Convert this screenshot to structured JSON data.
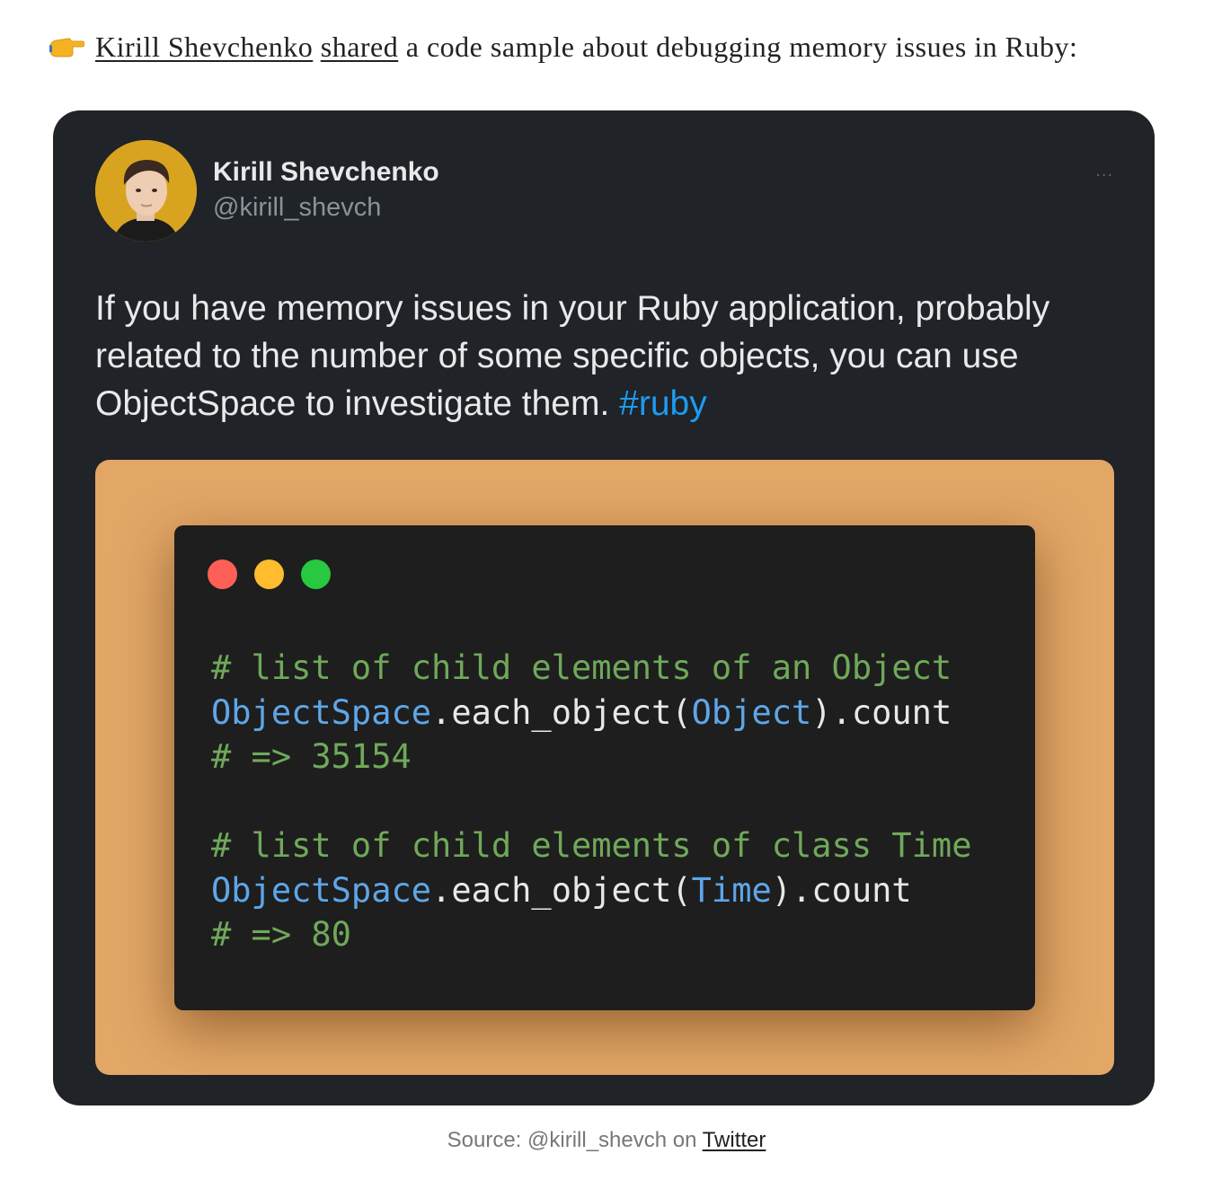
{
  "intro": {
    "emoji": "👉",
    "author_link": "Kirill Shevchenko",
    "shared_link": "shared",
    "text": "a code sample about debugging memory issues in Ruby:"
  },
  "tweet": {
    "author_name": "Kirill Shevchenko",
    "author_handle": "@kirill_shevch",
    "more_icon": "...",
    "text": "If you have memory issues in your Ruby application, probably related to the number of some specific objects, you can use ObjectSpace to investigate them.",
    "hashtag": "#ruby",
    "media": {
      "window_dots": [
        "red",
        "yellow",
        "green"
      ],
      "code_lines": [
        [
          {
            "t": "# list of child elements of an Object",
            "k": "cm"
          }
        ],
        [
          {
            "t": "ObjectSpace",
            "k": "cls"
          },
          {
            "t": ".each_object(",
            "k": "plain"
          },
          {
            "t": "Object",
            "k": "cls"
          },
          {
            "t": ").count",
            "k": "plain"
          }
        ],
        [
          {
            "t": "# => 35154",
            "k": "cm"
          }
        ],
        [],
        [
          {
            "t": "# list of child elements of class Time",
            "k": "cm"
          }
        ],
        [
          {
            "t": "ObjectSpace",
            "k": "cls"
          },
          {
            "t": ".each_object(",
            "k": "plain"
          },
          {
            "t": "Time",
            "k": "cls"
          },
          {
            "t": ").count",
            "k": "plain"
          }
        ],
        [
          {
            "t": "# => 80",
            "k": "cm"
          }
        ]
      ]
    }
  },
  "caption": {
    "prefix": "Source: @kirill_shevch on",
    "link": "Twitter"
  },
  "colors": {
    "tweet_bg": "#202327",
    "hashtag": "#1d9bf0",
    "media_bg": "#e2a667",
    "code_bg": "#1e1e1e",
    "comment": "#6fa95a",
    "class_name": "#5ea6e8"
  }
}
